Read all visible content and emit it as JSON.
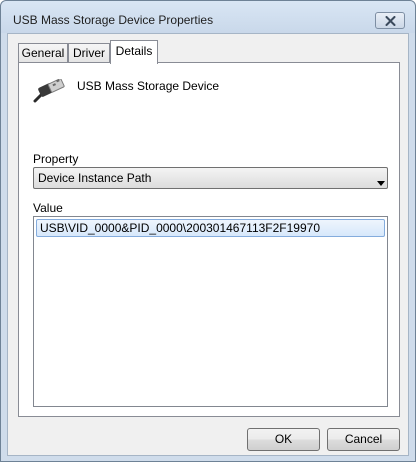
{
  "window": {
    "title": "USB Mass Storage Device Properties",
    "close_icon": "close-icon"
  },
  "tabs": [
    {
      "label": "General",
      "active": false
    },
    {
      "label": "Driver",
      "active": false
    },
    {
      "label": "Details",
      "active": true
    }
  ],
  "details": {
    "device_icon": "usb-connector-icon",
    "device_name": "USB Mass Storage Device",
    "property_label": "Property",
    "property_selected": "Device Instance Path",
    "value_label": "Value",
    "values": [
      "USB\\VID_0000&PID_0000\\200301467113F2F19970"
    ]
  },
  "buttons": {
    "ok": "OK",
    "cancel": "Cancel"
  },
  "colors": {
    "window_frame": "#cfdceb",
    "selection_border": "#84acdd"
  }
}
